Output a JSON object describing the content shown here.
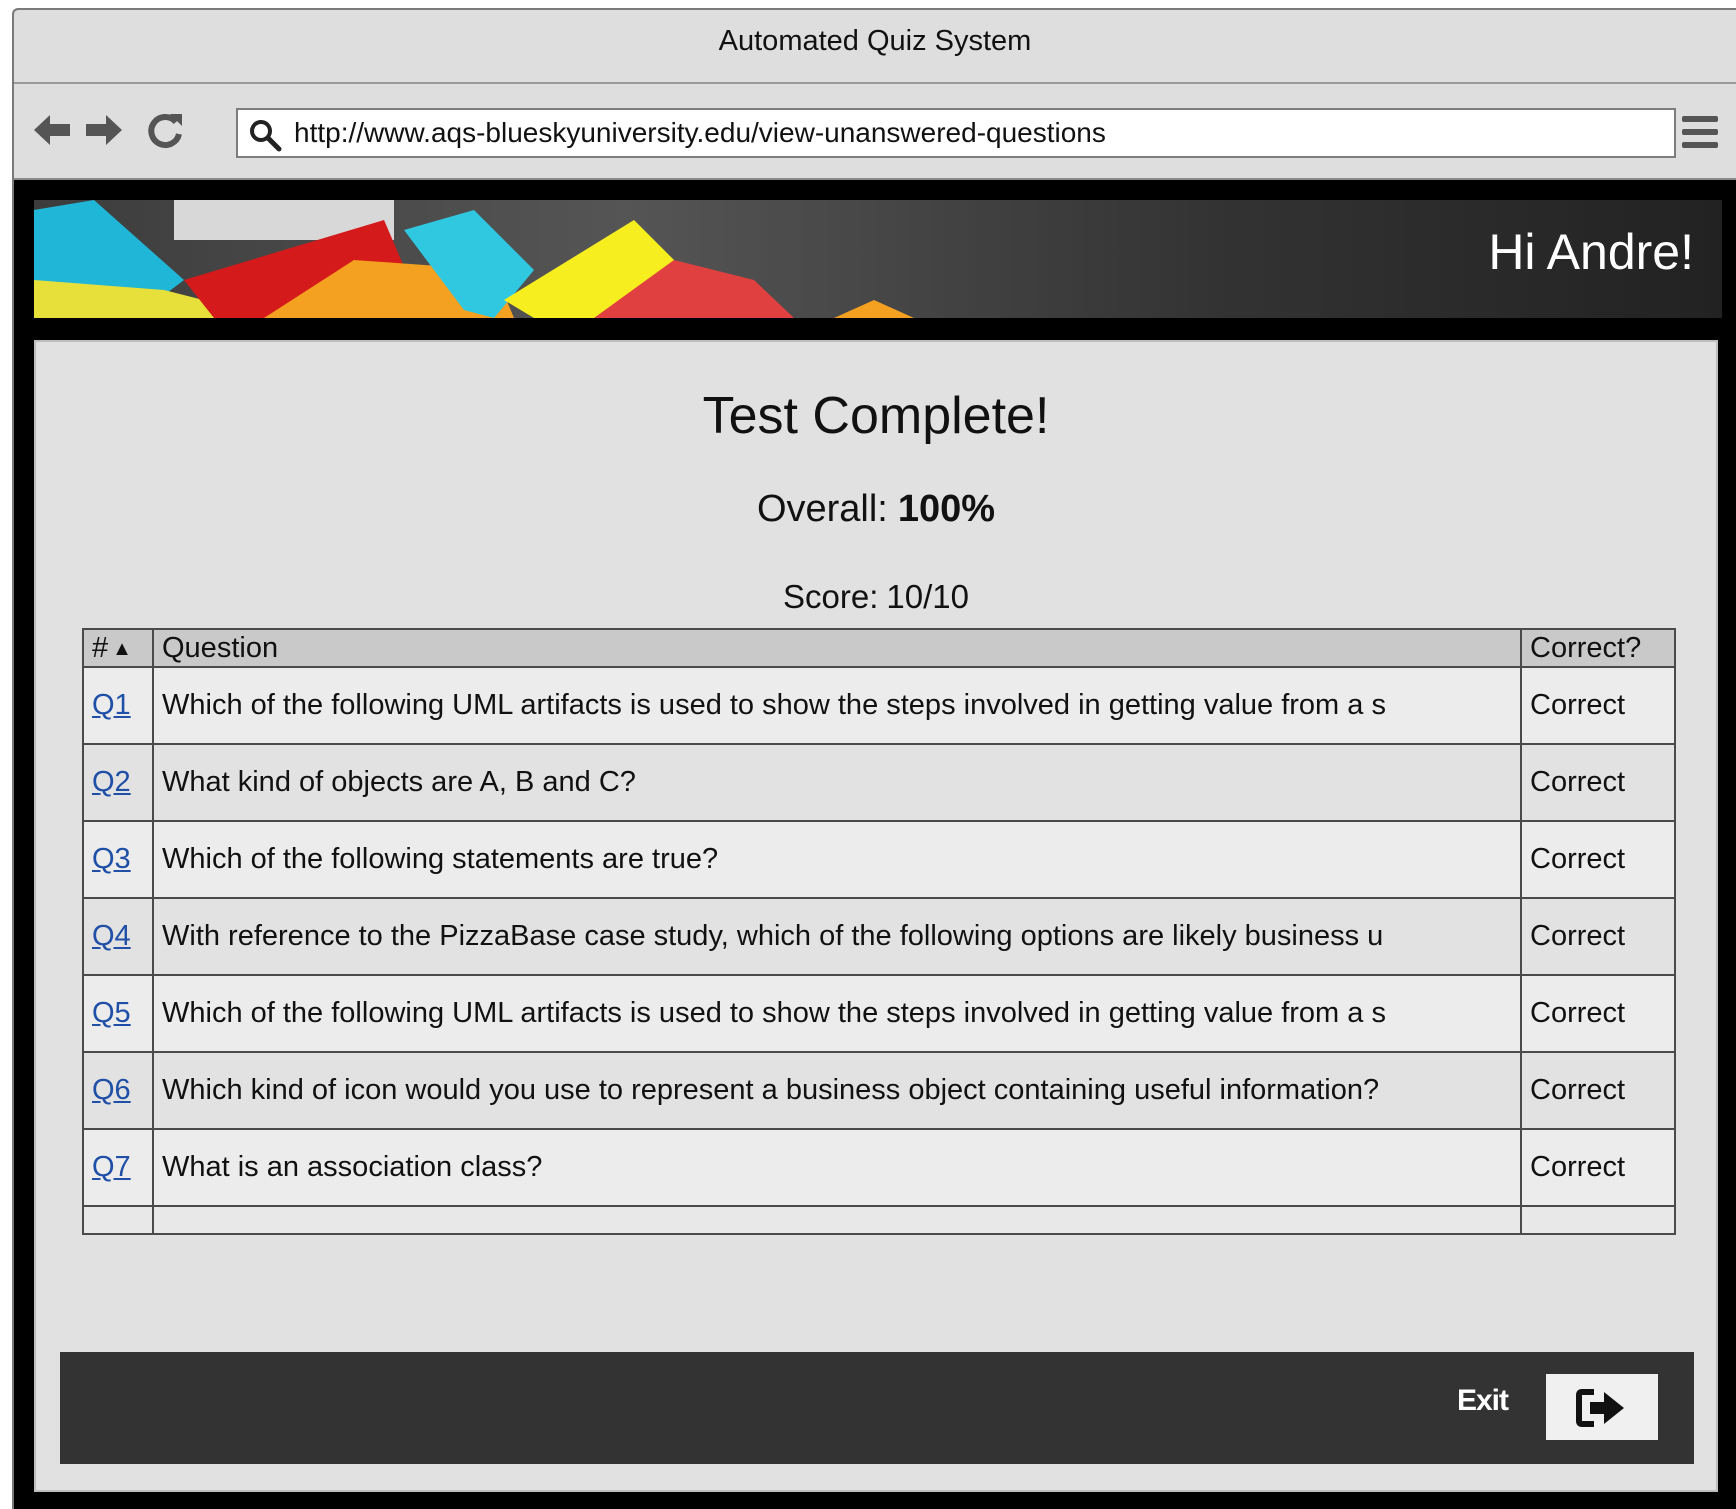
{
  "window": {
    "title": "Automated Quiz System"
  },
  "browser": {
    "url": "http://www.aqs-blueskyuniversity.edu/view-unanswered-questions",
    "icons": [
      "back-arrow-icon",
      "forward-arrow-icon",
      "refresh-icon",
      "search-icon",
      "hamburger-menu-icon"
    ]
  },
  "header": {
    "greeting": "Hi Andre!"
  },
  "main": {
    "title": "Test Complete!",
    "overall_label": "Overall:",
    "overall_value": "100%",
    "score_label": "Score:",
    "score_value": "10/10"
  },
  "table": {
    "headers": {
      "num": "#",
      "question": "Question",
      "correct": "Correct?"
    },
    "rows": [
      {
        "id": "Q1",
        "question": "Which of the following UML artifacts is used to show the steps involved in getting value from a s",
        "correct": "Correct"
      },
      {
        "id": "Q2",
        "question": "What kind of objects are A, B and C?",
        "correct": "Correct"
      },
      {
        "id": "Q3",
        "question": "Which of the following statements are true?",
        "correct": "Correct"
      },
      {
        "id": "Q4",
        "question": "With reference to the PizzaBase case study, which of the following options are likely business u",
        "correct": "Correct"
      },
      {
        "id": "Q5",
        "question": "Which of the following UML artifacts is used to show the steps involved in getting value from a s",
        "correct": "Correct"
      },
      {
        "id": "Q6",
        "question": "Which kind of icon would you use to represent a business object containing useful information?",
        "correct": "Correct"
      },
      {
        "id": "Q7",
        "question": "What is an association class?",
        "correct": "Correct"
      }
    ]
  },
  "footer": {
    "exit_label": "Exit"
  },
  "colors": {
    "link": "#1f4fa6",
    "footer_bg": "#333333",
    "content_bg": "#e1e1e1"
  }
}
